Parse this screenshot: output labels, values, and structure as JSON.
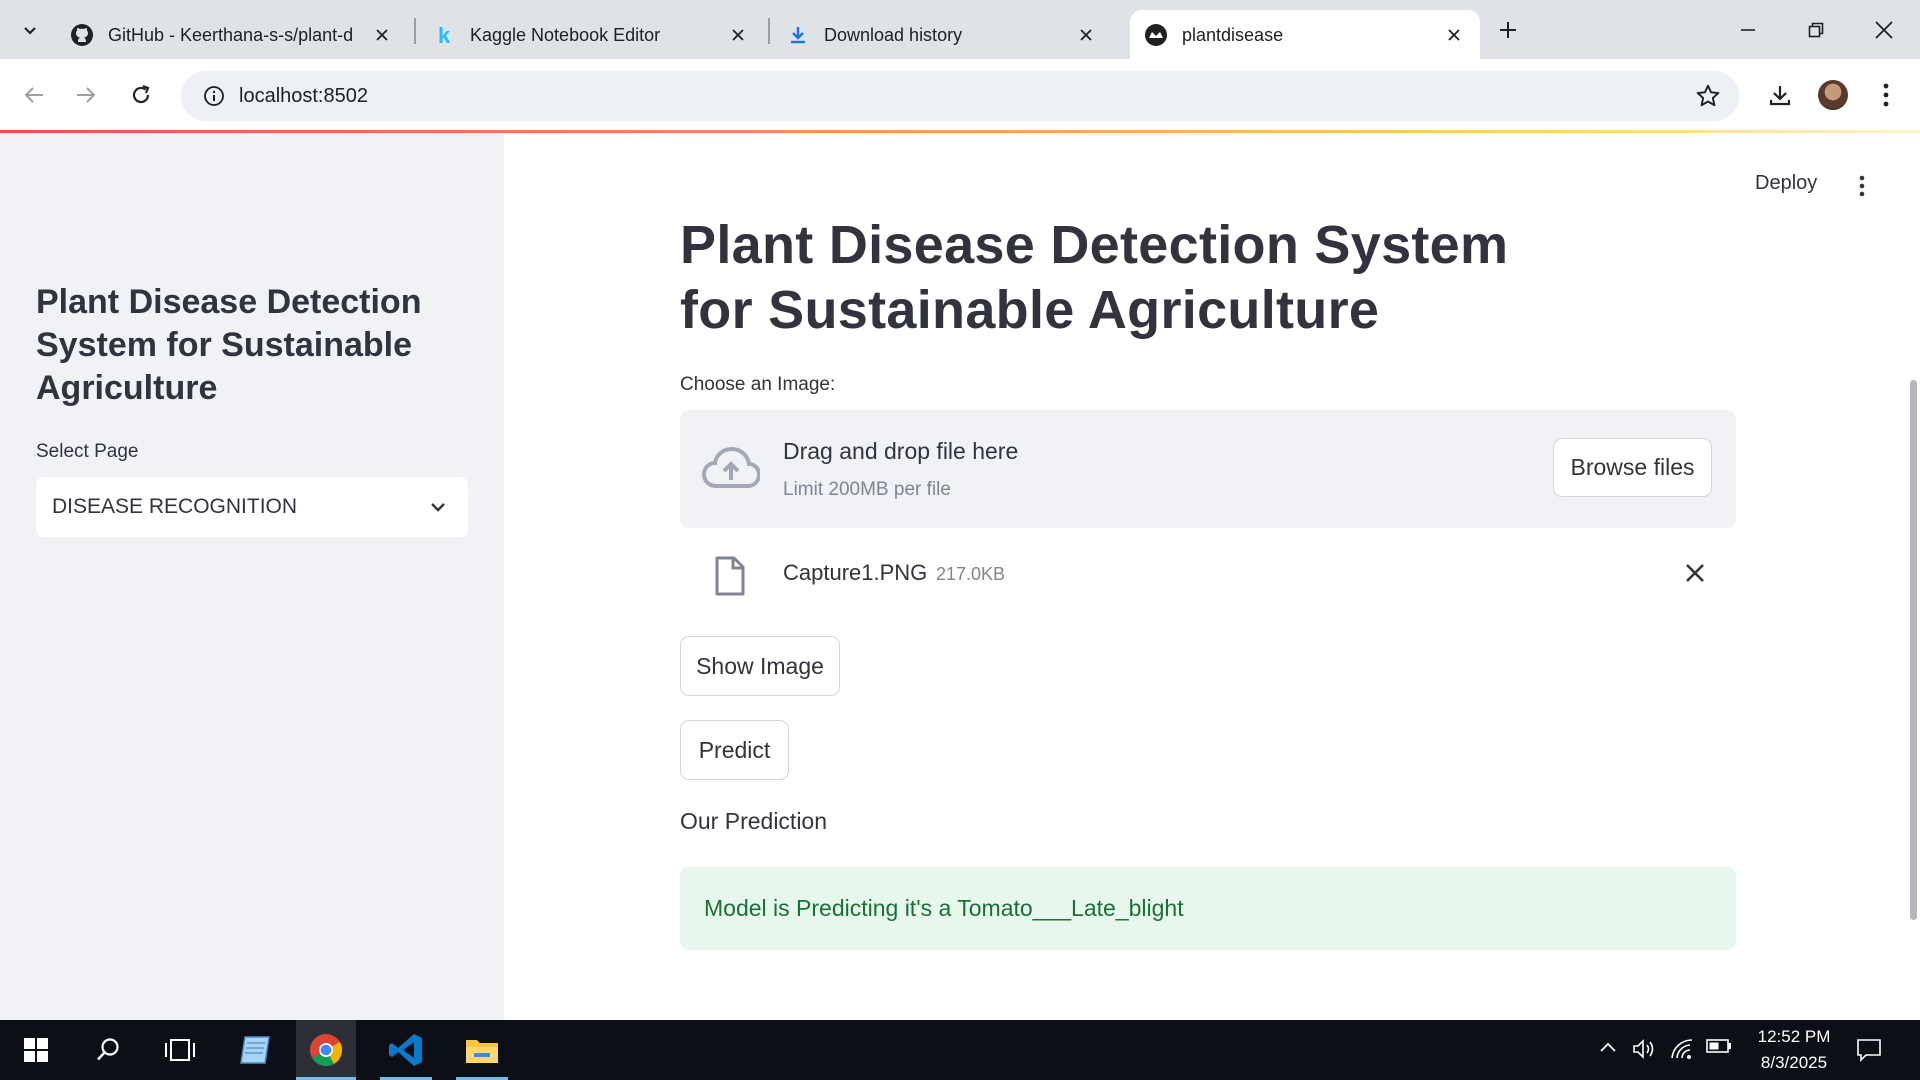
{
  "browser": {
    "tabs": [
      {
        "title": "GitHub - Keerthana-s-s/plant-d",
        "icon": "github-icon",
        "active": false
      },
      {
        "title": "Kaggle Notebook Editor",
        "icon": "kaggle-icon",
        "active": false
      },
      {
        "title": "Download history",
        "icon": "download-icon",
        "active": false
      },
      {
        "title": "plantdisease",
        "icon": "streamlit-icon",
        "active": true
      }
    ],
    "url": "localhost:8502"
  },
  "sidebar": {
    "title": "Plant Disease Detection System for Sustainable Agriculture",
    "select_label": "Select Page",
    "select_value": "DISEASE RECOGNITION"
  },
  "header": {
    "deploy_label": "Deploy"
  },
  "main": {
    "title": "Plant Disease Detection System for Sustainable Agriculture",
    "uploader_label": "Choose an Image:",
    "dropzone_text": "Drag and drop file here",
    "dropzone_limit": "Limit 200MB per file",
    "browse_label": "Browse files",
    "file": {
      "name": "Capture1.PNG",
      "size": "217.0KB"
    },
    "show_image_label": "Show Image",
    "predict_label": "Predict",
    "prediction_heading": "Our Prediction",
    "prediction_text": "Model is Predicting it's a Tomato___Late_blight"
  },
  "taskbar": {
    "time": "12:52 PM",
    "date": "8/3/2025"
  },
  "colors": {
    "sidebar_bg": "#f0f2f6",
    "success_bg": "#e8f7ee",
    "success_text": "#177233",
    "accent_bar": "#ff4b4b",
    "taskbar_bg": "#0c0f16"
  }
}
